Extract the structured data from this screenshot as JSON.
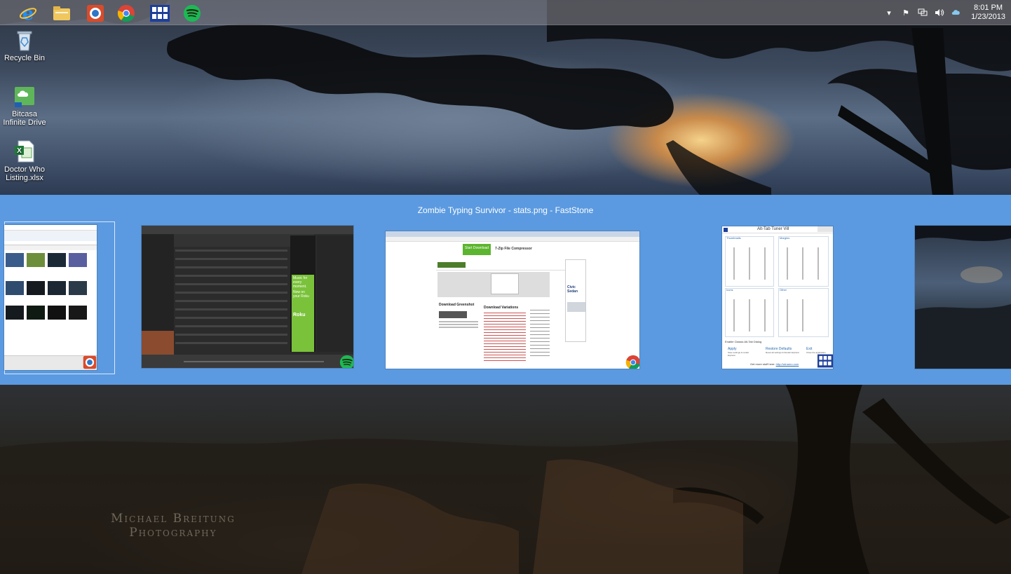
{
  "taskbar": {
    "pinned_apps": [
      {
        "name": "internet-explorer-icon"
      },
      {
        "name": "file-explorer-icon"
      },
      {
        "name": "faststone-icon"
      },
      {
        "name": "chrome-icon"
      },
      {
        "name": "alt-tab-tuner-icon"
      },
      {
        "name": "spotify-icon"
      }
    ],
    "tray": {
      "icons": [
        "show-hidden-icons-arrow",
        "action-center-flag-icon",
        "network-icon",
        "volume-icon",
        "bitcasa-icon"
      ],
      "time": "8:01 PM",
      "date": "1/23/2013"
    }
  },
  "desktop": {
    "icons": [
      {
        "label": "Recycle Bin",
        "icon": "recycle-bin-icon"
      },
      {
        "label": "Bitcasa Infinite Drive",
        "icon": "bitcasa-drive-icon"
      },
      {
        "label": "Doctor Who Listing.xlsx",
        "icon": "excel-file-icon"
      }
    ],
    "watermark_line1": "Michael Breitung",
    "watermark_line2": "Photography"
  },
  "alt_tab": {
    "selected_title": "Zombie Typing Survivor - stats.png - FastStone",
    "windows": [
      {
        "name": "FastStone Image Viewer",
        "app_icon": "faststone-icon",
        "selected": true
      },
      {
        "name": "Spotify",
        "app_icon": "spotify-icon",
        "selected": false
      },
      {
        "name": "Google Chrome",
        "app_icon": "chrome-icon",
        "selected": false
      },
      {
        "name": "Alt-Tab Tuner",
        "app_icon": "alt-tab-tuner-icon",
        "selected": false
      },
      {
        "name": "Desktop",
        "app_icon": "",
        "selected": false
      }
    ],
    "tuner": {
      "title": "Alt-Tab Tuner Vill",
      "group_thumbnails": "Thumbnails",
      "group_margins": "Margins",
      "group_icons": "Icons",
      "group_other": "Other",
      "checkbox_label": "Enable Classic Alt-Tab Dialog",
      "apply": "Apply",
      "apply_sub": "Save settings & restart Explorer",
      "restore": "Restore Defaults",
      "restore_sub": "Reset all settings & Restart Explorer",
      "exit": "Exit",
      "exit_sub": "Close the application",
      "footer": "Get more stuff here:",
      "footer_link": "http://winaero.com"
    },
    "chrome_page": {
      "download_button": "Start Download",
      "ad_title": "7-Zip File Compressor",
      "heading": "Download Greenshot",
      "heading2": "Download Variations",
      "ad_car": "Civic Sedan"
    },
    "spotify_ad": {
      "line1": "Music for every moment.",
      "line2": "Now on your Roku",
      "brand": "Roku"
    }
  }
}
